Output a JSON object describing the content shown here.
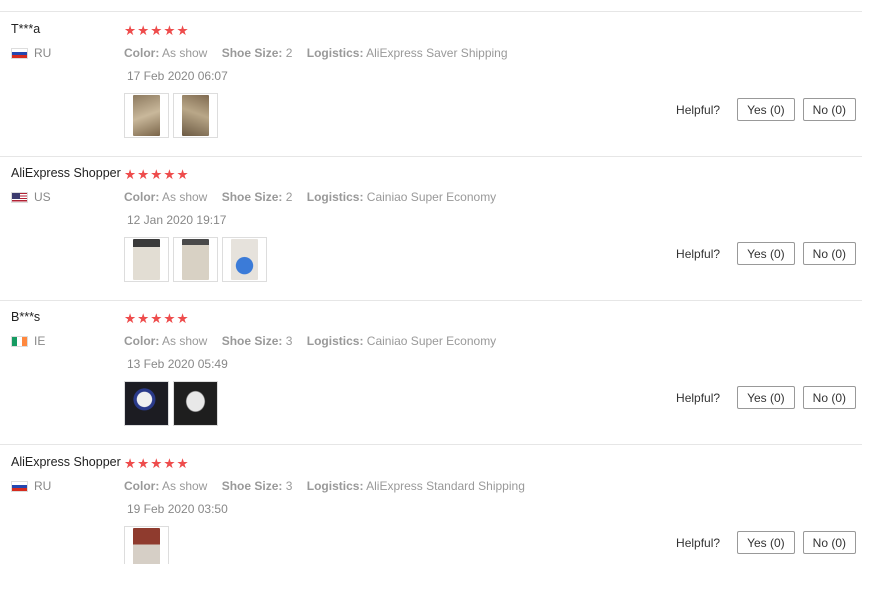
{
  "helpful_label": "Helpful?",
  "meta_labels": {
    "color": "Color:",
    "shoe_size": "Shoe Size:",
    "logistics": "Logistics:"
  },
  "reviews": [
    {
      "user": "T***a",
      "country": "RU",
      "flag": "ru",
      "stars": 5,
      "color": "As show",
      "shoe_size": "2",
      "logistics": "AliExpress Saver Shipping",
      "date": "17 Feb 2020 06:07",
      "yes": "Yes (0)",
      "no": "No (0)"
    },
    {
      "user": "AliExpress Shopper",
      "country": "US",
      "flag": "us",
      "stars": 5,
      "color": "As show",
      "shoe_size": "2",
      "logistics": "Cainiao Super Economy",
      "date": "12 Jan 2020 19:17",
      "yes": "Yes (0)",
      "no": "No (0)"
    },
    {
      "user": "B***s",
      "country": "IE",
      "flag": "ie",
      "stars": 5,
      "color": "As show",
      "shoe_size": "3",
      "logistics": "Cainiao Super Economy",
      "date": "13 Feb 2020 05:49",
      "yes": "Yes (0)",
      "no": "No (0)"
    },
    {
      "user": "AliExpress Shopper",
      "country": "RU",
      "flag": "ru",
      "stars": 5,
      "color": "As show",
      "shoe_size": "3",
      "logistics": "AliExpress Standard Shipping",
      "date": "19 Feb 2020 03:50",
      "yes": "Yes (0)",
      "no": "No (0)"
    }
  ],
  "photo_colors": [
    [
      "#a08a6e",
      "#8a7458"
    ],
    [
      "#d9d4cc",
      "#cfc8bd",
      "#2a3550"
    ],
    [
      "#1f2230",
      "#2b2b2b"
    ],
    [
      "#a04a3a"
    ]
  ]
}
